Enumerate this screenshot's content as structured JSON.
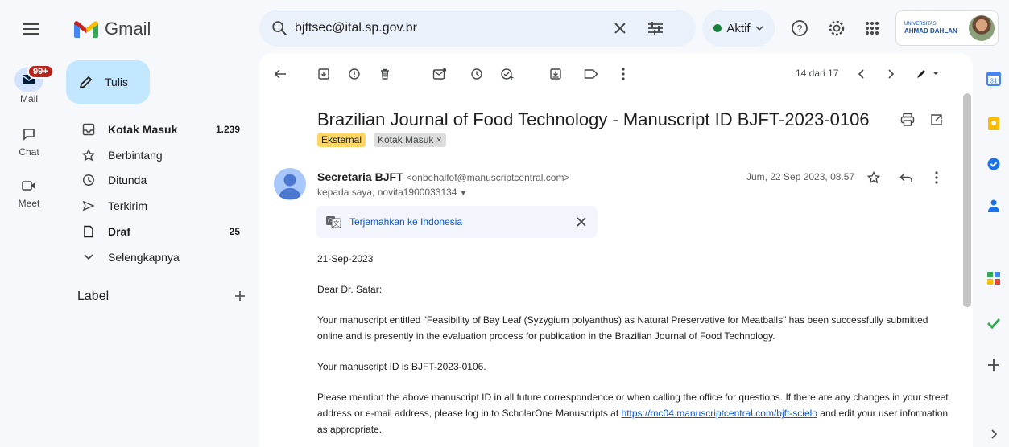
{
  "app": {
    "name": "Gmail"
  },
  "search": {
    "value": "bjftsec@ital.sp.gov.br"
  },
  "status": {
    "label": "Aktif"
  },
  "account": {
    "org_small": "UNIVERSITAS",
    "org_big": "AHMAD DAHLAN"
  },
  "rail": {
    "mail": {
      "label": "Mail",
      "badge": "99+"
    },
    "chat": {
      "label": "Chat"
    },
    "meet": {
      "label": "Meet"
    }
  },
  "compose": {
    "label": "Tulis"
  },
  "folders": [
    {
      "label": "Kotak Masuk",
      "count": "1.239",
      "icon": "inbox-icon"
    },
    {
      "label": "Berbintang",
      "count": "",
      "icon": "star-icon"
    },
    {
      "label": "Ditunda",
      "count": "",
      "icon": "clock-icon"
    },
    {
      "label": "Terkirim",
      "count": "",
      "icon": "send-icon"
    },
    {
      "label": "Draf",
      "count": "25",
      "icon": "draft-icon"
    },
    {
      "label": "Selengkapnya",
      "count": "",
      "icon": "chevron-down-icon"
    }
  ],
  "labels": {
    "heading": "Label"
  },
  "pager": {
    "text": "14 dari 17"
  },
  "message": {
    "subject": "Brazilian Journal of Food Technology - Manuscript ID BJFT-2023-0106",
    "chips": {
      "external": "Eksternal",
      "inbox": "Kotak Masuk ×"
    },
    "sender_name": "Secretaria BJFT",
    "sender_email": "<onbehalfof@manuscriptcentral.com>",
    "to": "kepada saya, novita1900033134",
    "date": "Jum, 22 Sep 2023, 08.57",
    "translate": "Terjemahkan ke Indonesia",
    "body": {
      "date_line": "21-Sep-2023",
      "greeting": "Dear Dr. Satar:",
      "p1": "Your manuscript entitled \"Feasibility of Bay Leaf (Syzygium polyanthus) as Natural Preservative for Meatballs\" has been successfully submitted online and is presently in the evaluation process for publication in the Brazilian Journal of Food Technology.",
      "p2": "Your manuscript ID is BJFT-2023-0106.",
      "p3_before": "Please mention the above manuscript ID in all future correspondence or when calling the office for questions. If there are any changes in your street address or e-mail address, please log in to ScholarOne Manuscripts at ",
      "p3_link": "https://mc04.manuscriptcentral.com/bjft-scielo",
      "p3_after": " and edit your user information as appropriate."
    }
  },
  "colors": {
    "compose_bg": "#c2e7ff",
    "active_rail": "#d3e3fd",
    "external_chip": "#fdd663",
    "link": "#0b57d0"
  }
}
